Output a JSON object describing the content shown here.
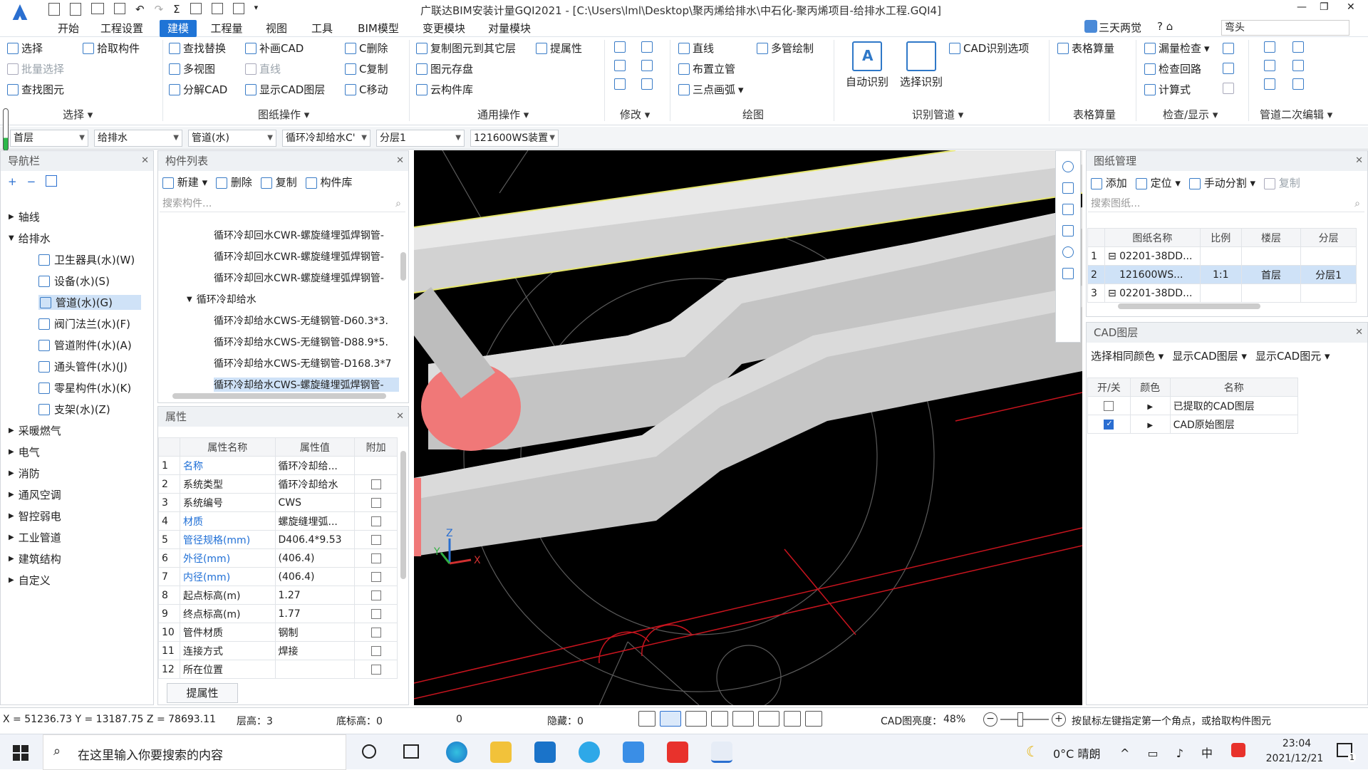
{
  "titlebar": {
    "title": "广联达BIM安装计量GQI2021 - [C:\\Users\\lml\\Desktop\\聚丙烯给排水\\中石化-聚丙烯项目-给排水工程.GQI4]",
    "user": "三天两觉",
    "search_value": "弯头"
  },
  "menu_tabs": [
    "开始",
    "工程设置",
    "建模",
    "工程量",
    "视图",
    "工具",
    "BIM模型",
    "变更模块",
    "对量模块"
  ],
  "ribbon": {
    "select_group": {
      "label": "选择",
      "items": [
        "选择",
        "拾取构件",
        "批量选择",
        "查找图元"
      ]
    },
    "drawing_ops": {
      "label": "图纸操作",
      "items": [
        "查找替换",
        "补画CAD",
        "C删除",
        "多视图",
        "直线",
        "C复制",
        "分解CAD",
        "显示CAD图层",
        "C移动"
      ]
    },
    "common_ops": {
      "label": "通用操作",
      "items": [
        "复制图元到其它层",
        "提属性",
        "图元存盘",
        "云构件库"
      ]
    },
    "modify": {
      "label": "修改"
    },
    "draw": {
      "label": "绘图",
      "items": [
        "直线",
        "多管绘制",
        "布置立管",
        "三点画弧"
      ]
    },
    "identify": {
      "label": "识别管道",
      "items": [
        "自动识别",
        "选择识别",
        "CAD识别选项"
      ]
    },
    "table_calc": {
      "label": "表格算量",
      "items": [
        "表格算量"
      ]
    },
    "check": {
      "label": "检查/显示",
      "items": [
        "漏量检查",
        "检查回路",
        "计算式"
      ]
    },
    "secondary": {
      "label": "管道二次编辑"
    }
  },
  "filters": [
    "首层",
    "给排水",
    "管道(水)",
    "循环冷却给水C'",
    "分层1",
    "121600WS装置"
  ],
  "nav": {
    "title": "导航栏",
    "items": [
      {
        "label": "轴线",
        "level": 0,
        "expanded": false
      },
      {
        "label": "给排水",
        "level": 0,
        "expanded": true
      },
      {
        "label": "卫生器具(水)(W)",
        "level": 1
      },
      {
        "label": "设备(水)(S)",
        "level": 1
      },
      {
        "label": "管道(水)(G)",
        "level": 1,
        "selected": true
      },
      {
        "label": "阀门法兰(水)(F)",
        "level": 1
      },
      {
        "label": "管道附件(水)(A)",
        "level": 1
      },
      {
        "label": "通头管件(水)(J)",
        "level": 1
      },
      {
        "label": "零星构件(水)(K)",
        "level": 1
      },
      {
        "label": "支架(水)(Z)",
        "level": 1
      },
      {
        "label": "采暖燃气",
        "level": 0
      },
      {
        "label": "电气",
        "level": 0
      },
      {
        "label": "消防",
        "level": 0
      },
      {
        "label": "通风空调",
        "level": 0
      },
      {
        "label": "智控弱电",
        "level": 0
      },
      {
        "label": "工业管道",
        "level": 0
      },
      {
        "label": "建筑结构",
        "level": 0
      },
      {
        "label": "自定义",
        "level": 0
      }
    ]
  },
  "component_list": {
    "title": "构件列表",
    "toolbar": [
      "新建",
      "删除",
      "复制",
      "构件库"
    ],
    "search_placeholder": "搜索构件...",
    "items": [
      "循环冷却回水CWR-螺旋缝埋弧焊钢管-",
      "循环冷却回水CWR-螺旋缝埋弧焊钢管-",
      "循环冷却回水CWR-螺旋缝埋弧焊钢管-",
      "循环冷却给水",
      "循环冷却给水CWS-无缝钢管-D60.3*3.",
      "循环冷却给水CWS-无缝钢管-D88.9*5.",
      "循环冷却给水CWS-无缝钢管-D168.3*7",
      "循环冷却给水CWS-螺旋缝埋弧焊钢管-"
    ]
  },
  "properties": {
    "title": "属性",
    "headers": [
      "属性名称",
      "属性值",
      "附加"
    ],
    "rows": [
      {
        "n": "1",
        "name": "名称",
        "value": "循环冷却给...",
        "blue": true,
        "cb": false
      },
      {
        "n": "2",
        "name": "系统类型",
        "value": "循环冷却给水",
        "blue": false,
        "cb": true
      },
      {
        "n": "3",
        "name": "系统编号",
        "value": "CWS",
        "blue": false,
        "cb": true
      },
      {
        "n": "4",
        "name": "材质",
        "value": "螺旋缝埋弧...",
        "blue": true,
        "cb": true
      },
      {
        "n": "5",
        "name": "管径规格(mm)",
        "value": "D406.4*9.53",
        "blue": true,
        "cb": true
      },
      {
        "n": "6",
        "name": "外径(mm)",
        "value": "(406.4)",
        "blue": true,
        "cb": true
      },
      {
        "n": "7",
        "name": "内径(mm)",
        "value": "(406.4)",
        "blue": true,
        "cb": true
      },
      {
        "n": "8",
        "name": "起点标高(m)",
        "value": "1.27",
        "blue": false,
        "cb": true
      },
      {
        "n": "9",
        "name": "终点标高(m)",
        "value": "1.77",
        "blue": false,
        "cb": true
      },
      {
        "n": "10",
        "name": "管件材质",
        "value": "钢制",
        "blue": false,
        "cb": true
      },
      {
        "n": "11",
        "name": "连接方式",
        "value": "焊接",
        "blue": false,
        "cb": true
      },
      {
        "n": "12",
        "name": "所在位置",
        "value": "",
        "blue": false,
        "cb": true
      }
    ],
    "extract_button": "提属性"
  },
  "drawing_mgmt": {
    "title": "图纸管理",
    "toolbar": [
      "添加",
      "定位",
      "手动分割",
      "复制"
    ],
    "search_placeholder": "搜索图纸...",
    "headers": [
      "图纸名称",
      "比例",
      "楼层",
      "分层"
    ],
    "rows": [
      {
        "n": "1",
        "name": "02201-38DD...",
        "scale": "",
        "floor": "",
        "layer": ""
      },
      {
        "n": "2",
        "name": "121600WS...",
        "scale": "1:1",
        "floor": "首层",
        "layer": "分层1"
      },
      {
        "n": "3",
        "name": "02201-38DD...",
        "scale": "",
        "floor": "",
        "layer": ""
      }
    ]
  },
  "cad_layers": {
    "title": "CAD图层",
    "toolbar": [
      "选择相同颜色",
      "显示CAD图层",
      "显示CAD图元"
    ],
    "headers": [
      "开/关",
      "颜色",
      "名称"
    ],
    "rows": [
      {
        "on": false,
        "name": "已提取的CAD图层"
      },
      {
        "on": true,
        "name": "CAD原始图层"
      }
    ]
  },
  "statusbar": {
    "coords": "X = 51236.73 Y = 13187.75 Z = 78693.11",
    "floor_height": "层高：3",
    "base_height": "底标高：0",
    "zero": "0",
    "hidden": "隐藏：0",
    "cad_brightness": "CAD图亮度：",
    "brightness_value": "48%",
    "hint": "按鼠标左键指定第一个角点，或拾取构件图元"
  },
  "taskbar": {
    "search_placeholder": "在这里输入你要搜索的内容",
    "weather": "0°C 晴朗",
    "time": "23:04",
    "date": "2021/12/21",
    "notifications": "1"
  },
  "colors": {
    "accent": "#1f74d6",
    "pipe": "#c8c8c8",
    "pipe_end": "#f07878",
    "cad_red": "#c8141e",
    "cad_yellow": "#e6e66e"
  }
}
